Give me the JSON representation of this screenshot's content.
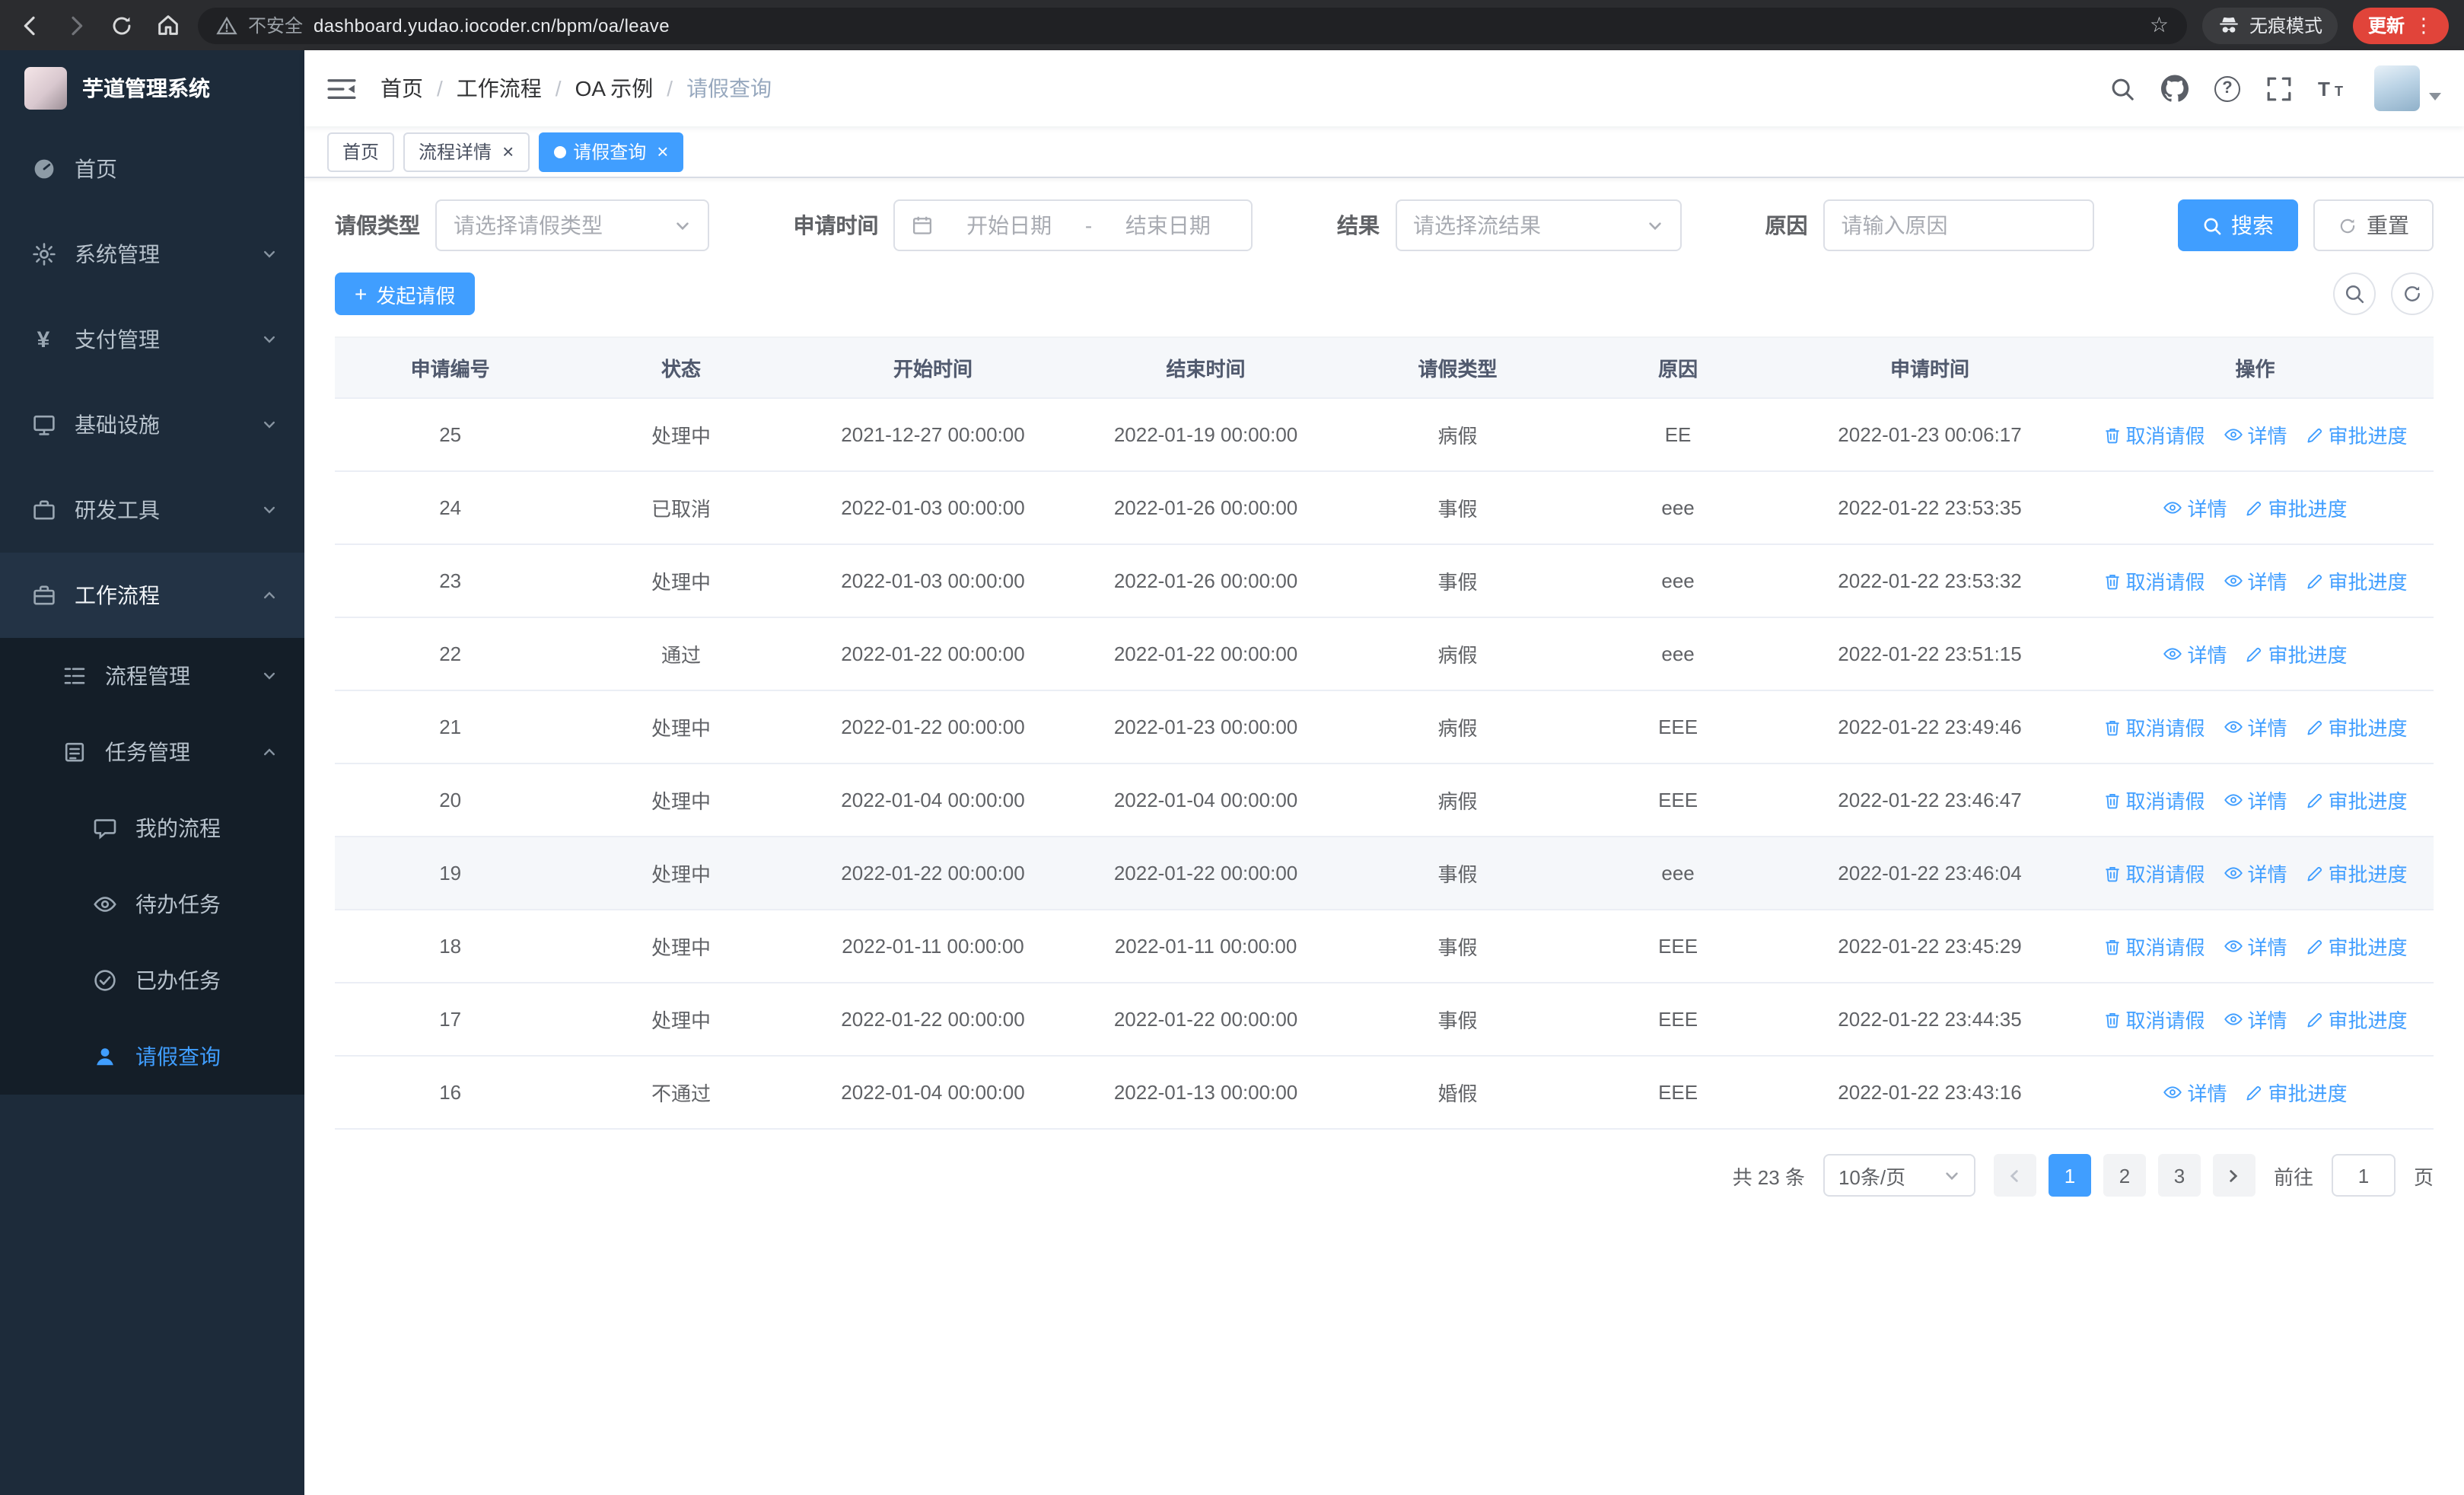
{
  "colors": {
    "primary": "#409eff",
    "sidebar_bg": "#1d2b3a",
    "update_badge": "#e1443a"
  },
  "browser": {
    "warning": "不安全",
    "url": "dashboard.yudao.iocoder.cn/bpm/oa/leave",
    "incognito": "无痕模式",
    "update": "更新"
  },
  "sidebar": {
    "title": "芋道管理系统",
    "items": [
      {
        "label": "首页"
      },
      {
        "label": "系统管理"
      },
      {
        "label": "支付管理"
      },
      {
        "label": "基础设施"
      },
      {
        "label": "研发工具"
      },
      {
        "label": "工作流程"
      },
      {
        "label": "流程管理"
      },
      {
        "label": "任务管理"
      },
      {
        "label": "我的流程"
      },
      {
        "label": "待办任务"
      },
      {
        "label": "已办任务"
      },
      {
        "label": "请假查询"
      }
    ]
  },
  "breadcrumb": [
    "首页",
    "工作流程",
    "OA 示例",
    "请假查询"
  ],
  "tags": [
    {
      "label": "首页",
      "active": false
    },
    {
      "label": "流程详情",
      "active": false
    },
    {
      "label": "请假查询",
      "active": true
    }
  ],
  "filters": {
    "type_label": "请假类型",
    "type_placeholder": "请选择请假类型",
    "time_label": "申请时间",
    "start_placeholder": "开始日期",
    "range_separator": "-",
    "end_placeholder": "结束日期",
    "result_label": "结果",
    "result_placeholder": "请选择流结果",
    "reason_label": "原因",
    "reason_placeholder": "请输入原因",
    "search": "搜索",
    "reset": "重置"
  },
  "toolbar": {
    "create": "发起请假"
  },
  "table": {
    "columns": [
      "申请编号",
      "状态",
      "开始时间",
      "结束时间",
      "请假类型",
      "原因",
      "申请时间",
      "操作"
    ],
    "action_labels": {
      "cancel": "取消请假",
      "detail": "详情",
      "progress": "审批进度"
    },
    "action_icons": {
      "cancel": "delete-icon",
      "detail": "view-icon",
      "progress": "edit-icon"
    },
    "rows": [
      {
        "id": "25",
        "status": "处理中",
        "start": "2021-12-27 00:00:00",
        "end": "2022-01-19 00:00:00",
        "type": "病假",
        "reason": "EE",
        "applied": "2022-01-23 00:06:17",
        "actions": [
          "cancel",
          "detail",
          "progress"
        ],
        "highlight": false
      },
      {
        "id": "24",
        "status": "已取消",
        "start": "2022-01-03 00:00:00",
        "end": "2022-01-26 00:00:00",
        "type": "事假",
        "reason": "eee",
        "applied": "2022-01-22 23:53:35",
        "actions": [
          "detail",
          "progress"
        ],
        "highlight": false
      },
      {
        "id": "23",
        "status": "处理中",
        "start": "2022-01-03 00:00:00",
        "end": "2022-01-26 00:00:00",
        "type": "事假",
        "reason": "eee",
        "applied": "2022-01-22 23:53:32",
        "actions": [
          "cancel",
          "detail",
          "progress"
        ],
        "highlight": false
      },
      {
        "id": "22",
        "status": "通过",
        "start": "2022-01-22 00:00:00",
        "end": "2022-01-22 00:00:00",
        "type": "病假",
        "reason": "eee",
        "applied": "2022-01-22 23:51:15",
        "actions": [
          "detail",
          "progress"
        ],
        "highlight": false
      },
      {
        "id": "21",
        "status": "处理中",
        "start": "2022-01-22 00:00:00",
        "end": "2022-01-23 00:00:00",
        "type": "病假",
        "reason": "EEE",
        "applied": "2022-01-22 23:49:46",
        "actions": [
          "cancel",
          "detail",
          "progress"
        ],
        "highlight": false
      },
      {
        "id": "20",
        "status": "处理中",
        "start": "2022-01-04 00:00:00",
        "end": "2022-01-04 00:00:00",
        "type": "病假",
        "reason": "EEE",
        "applied": "2022-01-22 23:46:47",
        "actions": [
          "cancel",
          "detail",
          "progress"
        ],
        "highlight": false
      },
      {
        "id": "19",
        "status": "处理中",
        "start": "2022-01-22 00:00:00",
        "end": "2022-01-22 00:00:00",
        "type": "事假",
        "reason": "eee",
        "applied": "2022-01-22 23:46:04",
        "actions": [
          "cancel",
          "detail",
          "progress"
        ],
        "highlight": true
      },
      {
        "id": "18",
        "status": "处理中",
        "start": "2022-01-11 00:00:00",
        "end": "2022-01-11 00:00:00",
        "type": "事假",
        "reason": "EEE",
        "applied": "2022-01-22 23:45:29",
        "actions": [
          "cancel",
          "detail",
          "progress"
        ],
        "highlight": false
      },
      {
        "id": "17",
        "status": "处理中",
        "start": "2022-01-22 00:00:00",
        "end": "2022-01-22 00:00:00",
        "type": "事假",
        "reason": "EEE",
        "applied": "2022-01-22 23:44:35",
        "actions": [
          "cancel",
          "detail",
          "progress"
        ],
        "highlight": false
      },
      {
        "id": "16",
        "status": "不通过",
        "start": "2022-01-04 00:00:00",
        "end": "2022-01-13 00:00:00",
        "type": "婚假",
        "reason": "EEE",
        "applied": "2022-01-22 23:43:16",
        "actions": [
          "detail",
          "progress"
        ],
        "highlight": false
      }
    ]
  },
  "pagination": {
    "total": "共 23 条",
    "page_size": "10条/页",
    "pages": [
      "1",
      "2",
      "3"
    ],
    "active_page": "1",
    "goto_label": "前往",
    "goto_value": "1",
    "page_label": "页"
  }
}
